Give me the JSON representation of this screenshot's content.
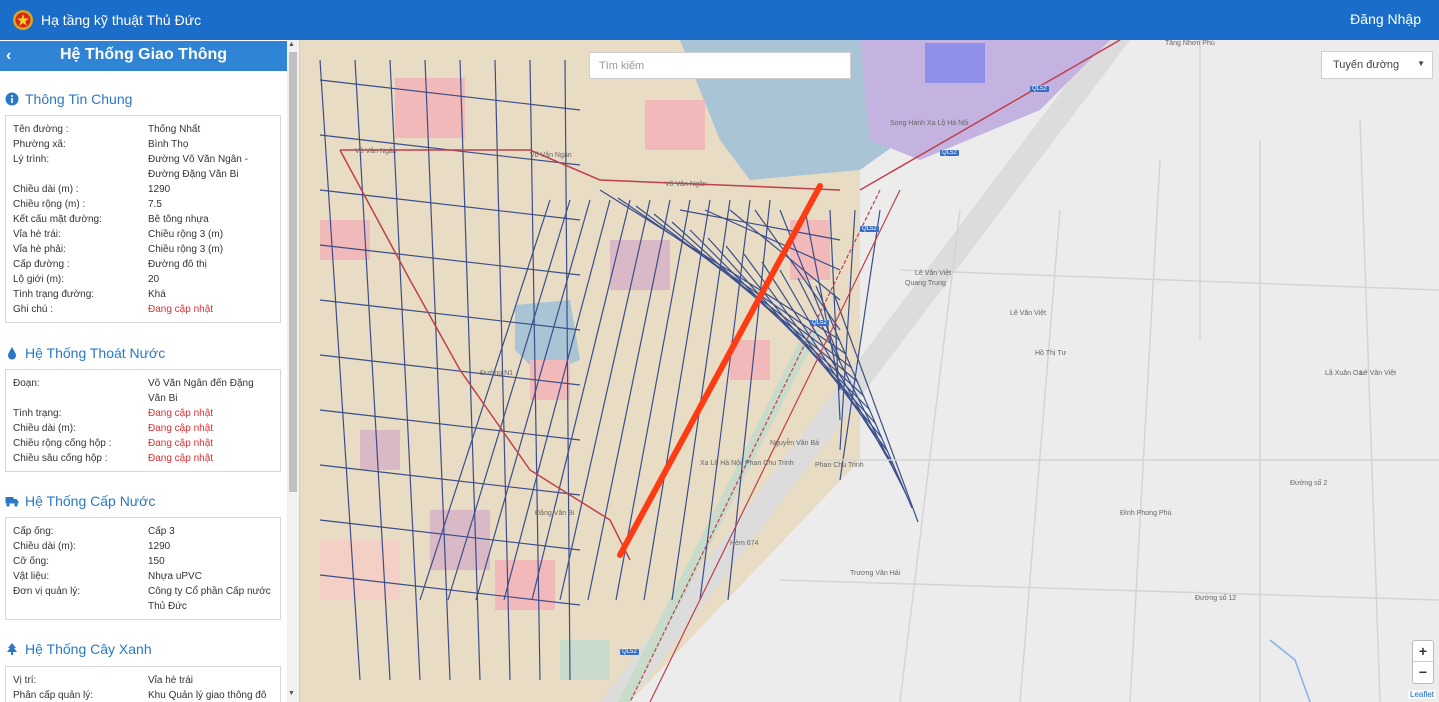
{
  "header": {
    "app_title": "Hạ tầng kỹ thuật Thủ Đức",
    "login_label": "Đăng Nhập",
    "logo_icon": "emblem-icon"
  },
  "sidebar": {
    "title": "Hệ Thống Giao Thông",
    "back_icon": "chevron-left-icon",
    "sections": {
      "general": {
        "title": "Thông Tin Chung",
        "icon": "info-icon",
        "rows": [
          {
            "k": "Tên đường :",
            "v": "Thống Nhất"
          },
          {
            "k": "Phường xã:",
            "v": "Bình Thọ"
          },
          {
            "k": "Lý trình:",
            "v": "Đường Võ Văn Ngân - Đường Đặng Văn Bi"
          },
          {
            "k": "Chiều dài (m) :",
            "v": "1290"
          },
          {
            "k": "Chiều rộng (m) :",
            "v": "7.5"
          },
          {
            "k": "Kết cấu mặt đường:",
            "v": "Bê tông nhựa"
          },
          {
            "k": "Vỉa hè trái:",
            "v": "Chiều rộng 3 (m)"
          },
          {
            "k": "Vỉa hè phải:",
            "v": "Chiều rộng 3 (m)"
          },
          {
            "k": "Cấp đường :",
            "v": "Đường đô thị"
          },
          {
            "k": "Lộ giới (m):",
            "v": "20"
          },
          {
            "k": "Tình trạng đường:",
            "v": "Khá"
          },
          {
            "k": "Ghi chú :",
            "v": "Đang cập nhật"
          }
        ]
      },
      "drainage": {
        "title": "Hệ Thống Thoát Nước",
        "icon": "water-drop-icon",
        "rows": [
          {
            "k": "Đoạn:",
            "v": "Võ Văn Ngân đến Đặng Văn Bi"
          },
          {
            "k": "Tình trạng:",
            "v": "Đang cập nhật"
          },
          {
            "k": "Chiều dài (m):",
            "v": "Đang cập nhật"
          },
          {
            "k": "Chiều rộng cống hộp :",
            "v": "Đang cập nhật"
          },
          {
            "k": "Chiều sâu cống hộp :",
            "v": "Đang cập nhật"
          }
        ]
      },
      "water": {
        "title": "Hệ Thống Cấp Nước",
        "icon": "truck-icon",
        "rows": [
          {
            "k": "Cấp ống:",
            "v": "Cấp 3"
          },
          {
            "k": "Chiều dài (m):",
            "v": "1290"
          },
          {
            "k": "Cỡ ống:",
            "v": "150"
          },
          {
            "k": "Vật liệu:",
            "v": "Nhựa uPVC"
          },
          {
            "k": "Đơn vị quản lý:",
            "v": "Công ty Cổ phần Cấp nước Thủ Đức"
          }
        ]
      },
      "trees": {
        "title": "Hệ Thống Cây Xanh",
        "icon": "tree-icon",
        "rows": [
          {
            "k": "Vị trí:",
            "v": "Vỉa hè trái"
          },
          {
            "k": "Phân cấp quản lý:",
            "v": "Khu Quản lý giao thông đô"
          }
        ]
      }
    }
  },
  "map": {
    "search_placeholder": "Tìm kiếm",
    "route_select": "Tuyến đường",
    "zoom_in": "+",
    "zoom_out": "−",
    "attribution": "Leaflet",
    "highway_shield": "QL52",
    "highlight_color": "#ff3b14",
    "labels": [
      "Võ Văn Ngân",
      "Võ Văn Ngân",
      "Võ Văn Ngân",
      "Lê Văn Việt",
      "Lê Văn Việt",
      "Lê Văn Việt",
      "Đặng Văn Bi",
      "Đường N1",
      "Phan Chu Trinh",
      "Phan Chu Trinh",
      "Trương Văn Hải",
      "Song Hành Xa Lộ Hà Nội",
      "Xa Lộ Hà Nội",
      "Nguyễn Văn Bá",
      "Quang Trung",
      "Hồ Thị Tư",
      "Lã Xuân Oai",
      "Đường số 2",
      "Đường số 12",
      "Hẻm 674",
      "Tăng Nhơn Phú",
      "Đình Phong Phú"
    ]
  }
}
